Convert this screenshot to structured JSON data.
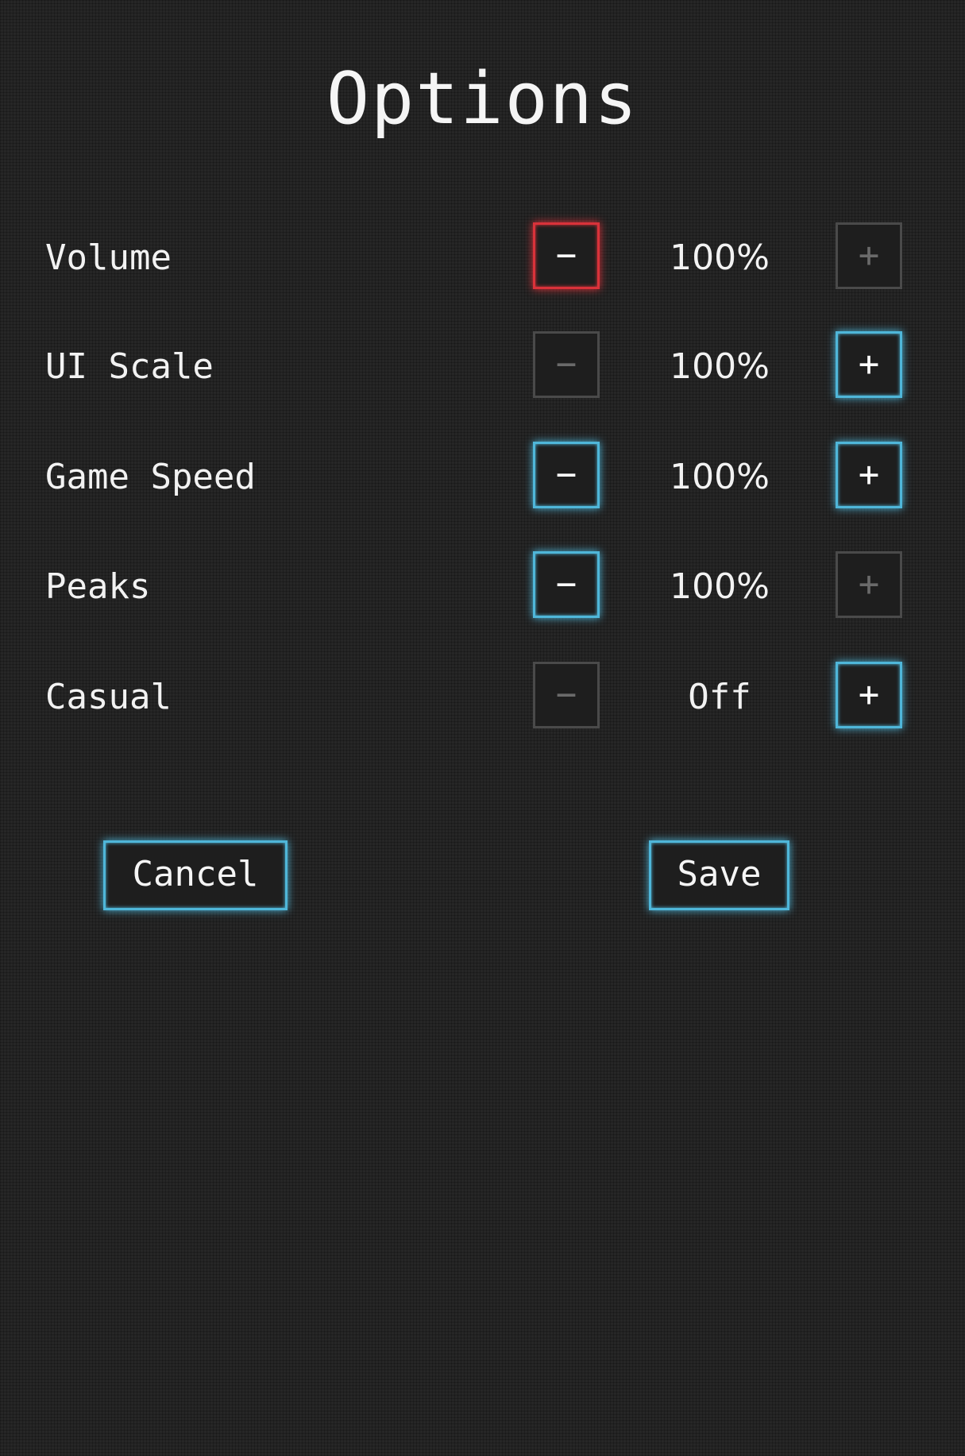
{
  "title": "Options",
  "colors": {
    "accent": "#4fb6d9",
    "danger": "#d9323a",
    "disabled": "#4a4a4a"
  },
  "icons": {
    "decrease": "minus-icon",
    "increase": "plus-icon"
  },
  "settings": [
    {
      "label": "Volume",
      "value": "100%",
      "minus": "−",
      "plus": "+",
      "minus_state": "danger",
      "plus_state": "disabled"
    },
    {
      "label": "UI Scale",
      "value": "100%",
      "minus": "−",
      "plus": "+",
      "minus_state": "disabled",
      "plus_state": "active"
    },
    {
      "label": "Game Speed",
      "value": "100%",
      "minus": "−",
      "plus": "+",
      "minus_state": "active",
      "plus_state": "active"
    },
    {
      "label": "Peaks",
      "value": "100%",
      "minus": "−",
      "plus": "+",
      "minus_state": "active",
      "plus_state": "disabled"
    },
    {
      "label": "Casual",
      "value": "Off",
      "minus": "−",
      "plus": "+",
      "minus_state": "disabled",
      "plus_state": "active"
    }
  ],
  "actions": {
    "cancel": "Cancel",
    "save": "Save"
  }
}
